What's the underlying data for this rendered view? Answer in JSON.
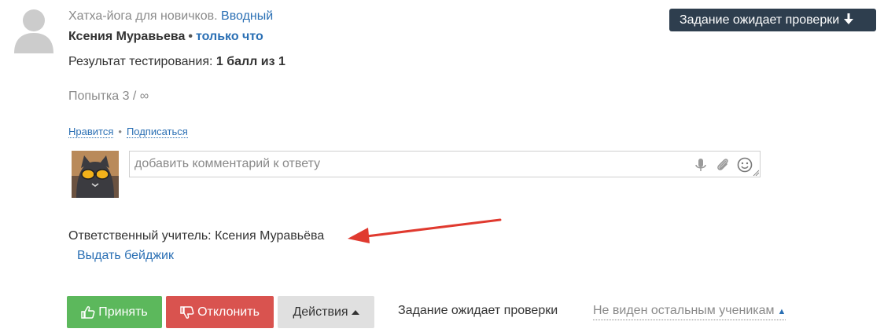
{
  "post": {
    "course": "Хатха-йога для новичков.",
    "lesson": "Вводный",
    "author": "Ксения Муравьева",
    "dot": "•",
    "time": "только что",
    "status_badge": "Задание ожидает проверки",
    "result_label": "Результат тестирования:",
    "result_value": "1 балл из 1",
    "attempt": "Попытка 3 / ∞"
  },
  "social": {
    "like": "Нравится",
    "separator": "•",
    "subscribe": "Подписаться"
  },
  "comment": {
    "placeholder": "добавить комментарий к ответу",
    "icons": [
      "microphone-icon",
      "paperclip-icon",
      "smiley-icon"
    ]
  },
  "teacher": {
    "label": "Ответственный учитель: Ксения Муравьёва",
    "badge_link": "Выдать бейджик"
  },
  "actions": {
    "accept": "Принять",
    "reject": "Отклонить",
    "more": "Действия",
    "status": "Задание ожидает проверки",
    "visibility": "Не виден остальным ученикам"
  },
  "colors": {
    "link": "#2a6fb4",
    "badge_bg": "#2e3e4e",
    "accept": "#5cb85c",
    "reject": "#d9534f",
    "actions_bg": "#e0e0e0",
    "annotation_arrow": "#e03a2f"
  }
}
